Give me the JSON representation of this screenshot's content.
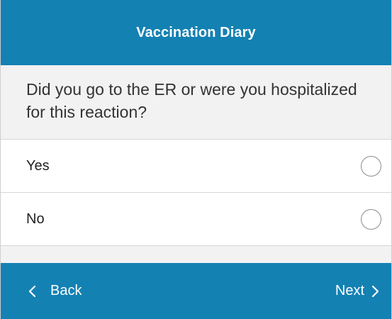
{
  "header": {
    "title": "Vaccination Diary"
  },
  "question": {
    "text": "Did you go to the ER or were you hospitalized for this reaction?"
  },
  "options": [
    {
      "label": "Yes",
      "selected": false
    },
    {
      "label": "No",
      "selected": false
    }
  ],
  "footer": {
    "back_label": "Back",
    "next_label": "Next",
    "back_icon": "chevron-left-icon",
    "next_icon": "chevron-right-icon"
  },
  "colors": {
    "brand": "#1481b3",
    "question_bg": "#f2f2f2"
  }
}
